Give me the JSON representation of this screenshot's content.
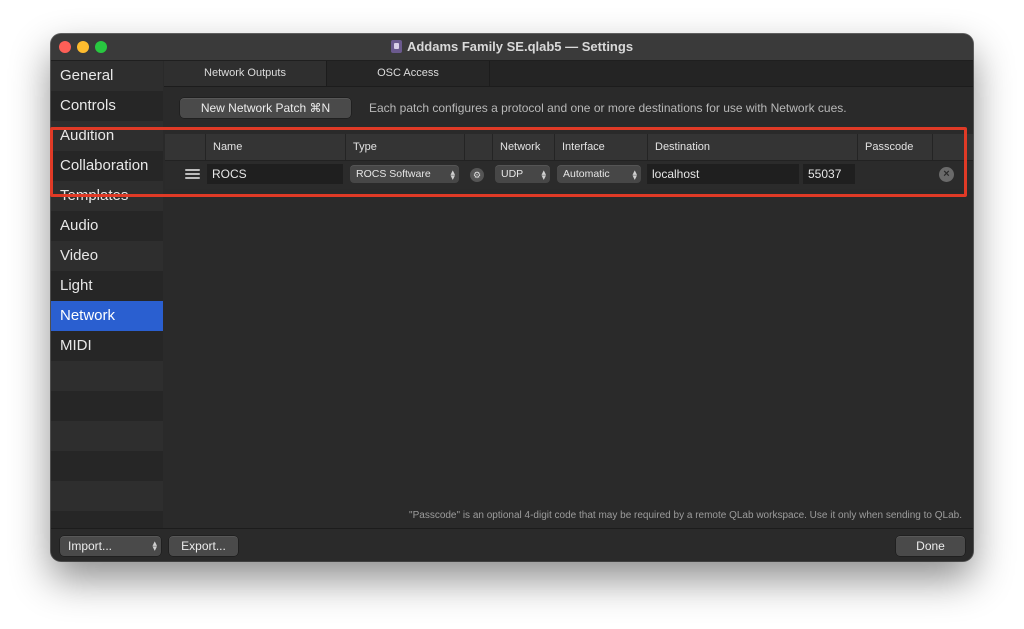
{
  "window": {
    "title": "Addams Family SE.qlab5 — Settings"
  },
  "sidebar": {
    "items": [
      {
        "label": "General"
      },
      {
        "label": "Controls"
      },
      {
        "label": "Audition"
      },
      {
        "label": "Collaboration"
      },
      {
        "label": "Templates"
      },
      {
        "label": "Audio"
      },
      {
        "label": "Video"
      },
      {
        "label": "Light"
      },
      {
        "label": "Network",
        "selected": true
      },
      {
        "label": "MIDI"
      }
    ]
  },
  "tabs": [
    {
      "label": "Network Outputs",
      "active": true
    },
    {
      "label": "OSC Access",
      "active": false
    }
  ],
  "toolbar": {
    "new_patch_label": "New Network Patch  ⌘N",
    "hint": "Each patch configures a protocol and one or more destinations for use with Network cues."
  },
  "table": {
    "headers": {
      "name": "Name",
      "type": "Type",
      "network": "Network",
      "interface": "Interface",
      "destination": "Destination",
      "passcode": "Passcode"
    },
    "row": {
      "name": "ROCS",
      "type": "ROCS Software",
      "network": "UDP",
      "interface": "Automatic",
      "destination": "localhost",
      "port": "55037",
      "passcode": ""
    }
  },
  "footnote": "\"Passcode\" is an optional 4-digit code that may be required by a remote QLab workspace. Use it only when sending to QLab.",
  "bottom": {
    "import_label": "Import...",
    "export_label": "Export...",
    "done_label": "Done"
  },
  "colors": {
    "selection": "#2a5fd0",
    "highlight_border": "#e03a26",
    "close": "#fe5f57",
    "minimize": "#febc2e",
    "maximize": "#28c840"
  },
  "icons": {
    "drag_handle": "hamburger-icon",
    "settings": "gear-icon",
    "remove": "close-circle-icon"
  }
}
